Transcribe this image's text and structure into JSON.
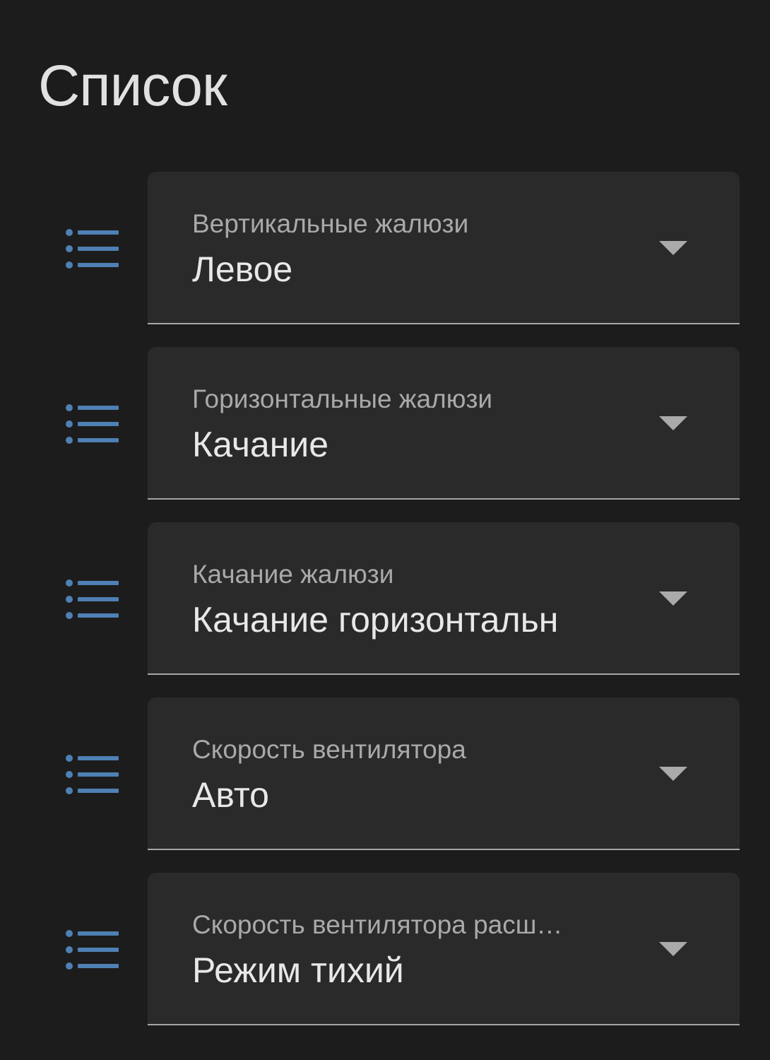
{
  "card": {
    "title": "Список"
  },
  "colors": {
    "background": "#1c1c1c",
    "field": "#2a2a2a",
    "icon": "#4e80b4",
    "label": "#a9a9a9",
    "value": "#e8e8e8"
  },
  "rows": [
    {
      "icon": "format-list-bulleted-icon",
      "label": "Вертикальные жалюзи",
      "value": "Левое"
    },
    {
      "icon": "format-list-bulleted-icon",
      "label": "Горизонтальные жалюзи",
      "value": "Качание"
    },
    {
      "icon": "format-list-bulleted-icon",
      "label": "Качание жалюзи",
      "value": "Качание горизонтальн"
    },
    {
      "icon": "format-list-bulleted-icon",
      "label": "Скорость вентилятора",
      "value": "Авто"
    },
    {
      "icon": "format-list-bulleted-icon",
      "label": "Скорость вентилятора расш…",
      "value": "Режим тихий"
    }
  ]
}
